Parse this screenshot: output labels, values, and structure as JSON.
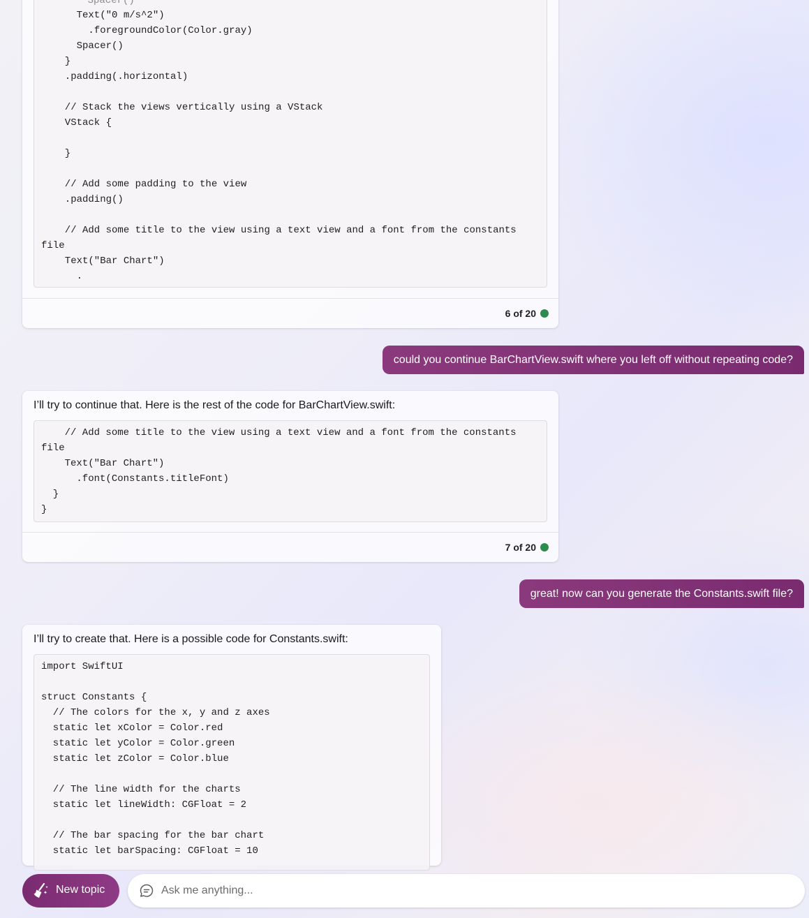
{
  "conversation": {
    "card1": {
      "code_lines": [
        "    Spacer()",
        "    Text(\"0 m/s^2\")",
        "      .foregroundColor(Color.gray)",
        "    Spacer()",
        "  }",
        "  .padding(.horizontal)",
        "",
        "  // Stack the views vertically using a VStack",
        "  VStack {",
        "",
        "  }",
        "",
        "  // Add some padding to the view",
        "  .padding()",
        "",
        "  // Add some title to the view using a text view and a font from the constants",
        "file",
        "  Text(\"Bar Chart\")",
        "    ."
      ],
      "counter": "6 of 20"
    },
    "user_message_1": "could you continue BarChartView.swift where you left off without repeating code?",
    "card2": {
      "intro": "I’ll try to continue that. Here is the rest of the code for BarChartView.swift:",
      "code_lines": [
        "    // Add some title to the view using a text view and a font from the constants",
        "file",
        "    Text(\"Bar Chart\")",
        "      .font(Constants.titleFont)",
        "  }",
        "}"
      ],
      "counter": "7 of 20"
    },
    "user_message_2": "great! now can you generate the Constants.swift file?",
    "card3": {
      "intro": "I’ll try to create that. Here is a possible code for Constants.swift:",
      "code_lines": [
        "import SwiftUI",
        "",
        "struct Constants {",
        "  // The colors for the x, y and z axes",
        "  static let xColor = Color.red",
        "  static let yColor = Color.green",
        "  static let zColor = Color.blue",
        "",
        "  // The line width for the charts",
        "  static let lineWidth: CGFloat = 2",
        "",
        "  // The bar spacing for the bar chart",
        "  static let barSpacing: CGFloat = 10"
      ]
    }
  },
  "composer": {
    "new_topic_label": "New topic",
    "new_topic_icon": "broom-sparkle-icon",
    "chat_icon": "chat-bubble-icon",
    "placeholder": "Ask me anything..."
  },
  "colors": {
    "accent": "#7a2b70",
    "status_dot": "#2e8b4e"
  }
}
